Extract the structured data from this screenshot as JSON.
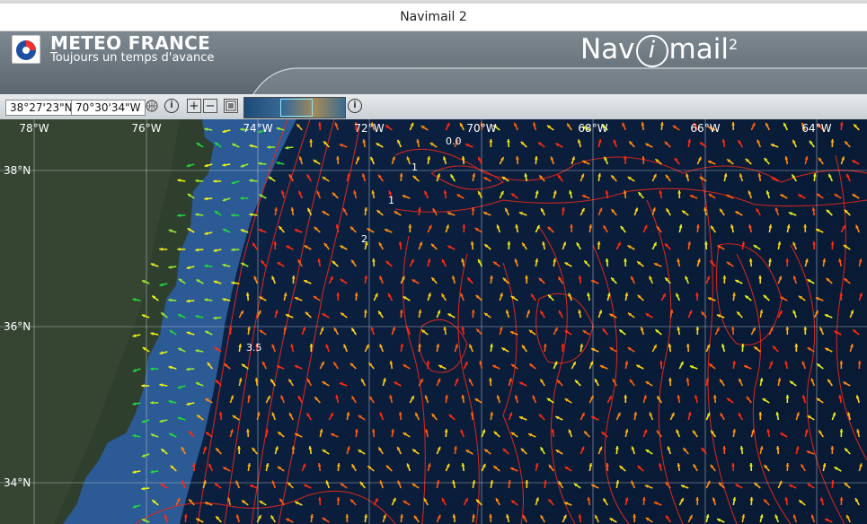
{
  "window": {
    "title": "Navimail 2"
  },
  "banner": {
    "brand": "METEO FRANCE",
    "slogan": "Toujours un temps d'avance",
    "app_logo": {
      "prefix": "Nav",
      "i": "i",
      "suffix": "mail",
      "sup": "2"
    }
  },
  "toolbar": {
    "latitude": "38°27'23\"N",
    "longitude": "70°30'34\"W",
    "info_symbol": "i",
    "zoom_in_symbol": "+",
    "zoom_out_symbol": "−"
  },
  "map": {
    "lon_labels": [
      "78°W",
      "76°W",
      "74°W",
      "72°W",
      "70°W",
      "68°W",
      "66°W",
      "64°W"
    ],
    "lat_labels": [
      "38°N",
      "36°N",
      "34°N"
    ],
    "contour_labels": [
      "0.0",
      "1",
      "1",
      "2",
      "3.5"
    ],
    "colors": {
      "ocean_deep": "#0a1d3a",
      "shelf": "#2e5f9a",
      "land": "#2f3f2e",
      "contour": "#e0281e",
      "grid": "#d8dde6"
    }
  }
}
